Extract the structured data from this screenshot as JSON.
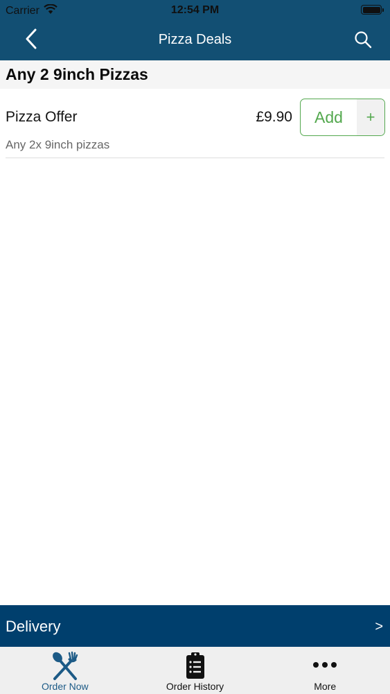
{
  "status_bar": {
    "carrier": "Carrier",
    "time": "12:54 PM"
  },
  "nav": {
    "title": "Pizza Deals",
    "back_icon": "chevron-left-icon",
    "search_icon": "search-icon"
  },
  "section": {
    "title": "Any 2 9inch Pizzas"
  },
  "items": [
    {
      "name": "Pizza Offer",
      "description": "Any 2x 9inch pizzas",
      "price": "£9.90",
      "add_label": "Add",
      "plus_label": "+"
    }
  ],
  "delivery": {
    "label": "Delivery",
    "chevron": ">"
  },
  "tabs": [
    {
      "label": "Order Now",
      "icon": "utensils-icon",
      "active": true
    },
    {
      "label": "Order History",
      "icon": "clipboard-list-icon",
      "active": false
    },
    {
      "label": "More",
      "icon": "more-dots-icon",
      "active": false
    }
  ],
  "colors": {
    "nav_bg": "#124f73",
    "delivery_bg": "#003f6d",
    "accent_green": "#53a84e",
    "active_tab": "#1c5a86"
  }
}
